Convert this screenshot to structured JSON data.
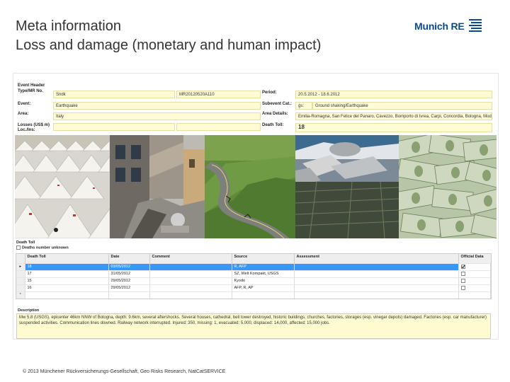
{
  "header": {
    "title_line1": "Meta information",
    "title_line2": "Loss and damage (monetary and human impact)",
    "logo_text": "Munich RE"
  },
  "form": {
    "section_label": "Event Header",
    "type_label": "Type/MR No.",
    "type_value": "Sndk",
    "mr_no_value": "MR20120520A110",
    "period_label": "Period:",
    "period_value": "20.5.2012 - 18.6.2012",
    "event_label": "Event:",
    "event_value": "Earthquake",
    "subevent_label": "Subevent Cat.:",
    "subevent_code": "gs:",
    "subevent_value": "Ground shaking/Earthquake",
    "area_label": "Area:",
    "area_value": "Italy",
    "area_details_label": "Area Details:",
    "area_details_value": "Emilia-Romagna, San Felice del Panaro, Cavezzo, Bomporto di Ivrea, Carpi, Concordia, Bologna, Modena, ...",
    "losses_label": "Losses (US$ m) Loc./Ins:",
    "death_toll_label": "Death Toll:",
    "death_toll_value": "18"
  },
  "photos": [
    {
      "name": "tents-photo"
    },
    {
      "name": "collapsed-building-photo"
    },
    {
      "name": "cracked-road-photo"
    },
    {
      "name": "damaged-ships-photo"
    },
    {
      "name": "money-photo"
    }
  ],
  "death_toll_section": {
    "label": "Death Toll",
    "checkbox_label": "Deaths number unknown"
  },
  "grid": {
    "headers": [
      "Death Toll",
      "Date",
      "Comment",
      "Source",
      "Assessment",
      "Official Data"
    ],
    "rows": [
      {
        "toll": "18",
        "date": "03/05/2012",
        "comment": "",
        "source": "R, AFP",
        "assessment": "",
        "official": true,
        "selected": true
      },
      {
        "toll": "17",
        "date": "31/05/2012",
        "comment": "",
        "source": "SZ, Welt Kompakt, USGS",
        "assessment": "",
        "official": false,
        "selected": false
      },
      {
        "toll": "15",
        "date": "29/05/2012",
        "comment": "",
        "source": "Kyodo",
        "assessment": "",
        "official": false,
        "selected": false
      },
      {
        "toll": "16",
        "date": "29/05/2012",
        "comment": "",
        "source": "AFP, R, AP",
        "assessment": "",
        "official": false,
        "selected": false
      }
    ],
    "row_marker": "▸",
    "new_marker": "*"
  },
  "description": {
    "label": "Description",
    "text": "Mw 5.8 (USGS), epicenter 46km NNW of Bologna, depth: 9.6km, several aftershocks. Several houses, cathedral, bell tower destroyed, historic buildings, churches, factories, storages (esp. vinegar depots) damaged. Factories (esp. car manufacturer) suspended activities. Communication lines downed. Railway network interrupted. Injured: 350, missing: 1, evacuated: 5,000, displaced: 14,000, affected: 15,000 jobs."
  },
  "footer": {
    "text": "© 2013 Münchener Rückversicherungs-Gesellschaft, Geo Risks Research, NatCatSERVICE"
  },
  "colors": {
    "brand": "#0b4a8e",
    "field_bg": "#fefbd5",
    "selection": "#3399ff"
  }
}
